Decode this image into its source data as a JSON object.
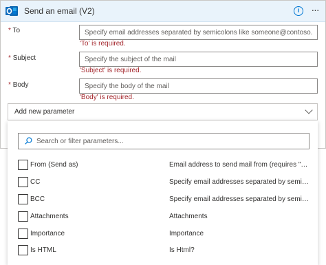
{
  "header": {
    "title": "Send an email (V2)",
    "app_icon": "outlook-icon",
    "info_icon": "info-icon",
    "more_icon": "more-icon",
    "header_bg": "#e9f3fb",
    "accent": "#0078d4"
  },
  "fields": {
    "to": {
      "required_mark": "*",
      "label": "To",
      "placeholder": "Specify email addresses separated by semicolons like someone@contoso.com",
      "value": "",
      "error": "'To' is required."
    },
    "subject": {
      "required_mark": "*",
      "label": "Subject",
      "placeholder": "Specify the subject of the mail",
      "value": "",
      "error": "'Subject' is required."
    },
    "body": {
      "required_mark": "*",
      "label": "Body",
      "placeholder": "Specify the body of the mail",
      "value": "",
      "error": "'Body' is required."
    },
    "error_color": "#a4262c"
  },
  "add_parameter": {
    "label": "Add new parameter",
    "icon": "chevron-down-icon"
  },
  "dropdown": {
    "search_placeholder": "Search or filter parameters...",
    "search_value": "",
    "search_icon": "search-icon",
    "parameters": [
      {
        "name": "From (Send as)",
        "description": "Email address to send mail from (requires \"Sen...",
        "checked": false
      },
      {
        "name": "CC",
        "description": "Specify email addresses separated by semicolo...",
        "checked": false
      },
      {
        "name": "BCC",
        "description": "Specify email addresses separated by semicolo...",
        "checked": false
      },
      {
        "name": "Attachments",
        "description": "Attachments",
        "checked": false
      },
      {
        "name": "Importance",
        "description": "Importance",
        "checked": false
      },
      {
        "name": "Is HTML",
        "description": "Is Html?",
        "checked": false
      }
    ]
  }
}
